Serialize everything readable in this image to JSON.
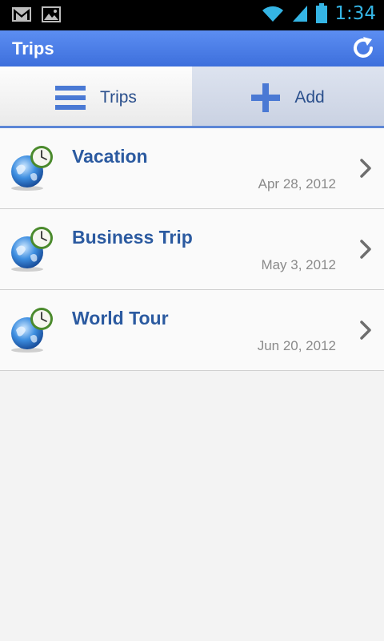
{
  "status_bar": {
    "time": "1:34",
    "icons": [
      "gmail-icon",
      "gallery-icon",
      "wifi-icon",
      "signal-icon",
      "battery-icon"
    ]
  },
  "action_bar": {
    "title": "Trips",
    "refresh_icon": "refresh-icon"
  },
  "tabs": [
    {
      "label": "Trips",
      "icon": "list-icon",
      "selected": true
    },
    {
      "label": "Add",
      "icon": "plus-icon",
      "selected": false
    }
  ],
  "trips": [
    {
      "title": "Vacation",
      "date": "Apr 28, 2012"
    },
    {
      "title": "Business Trip",
      "date": "May 3, 2012"
    },
    {
      "title": "World Tour",
      "date": "Jun 20, 2012"
    }
  ],
  "colors": {
    "accent": "#3d6fdc",
    "title_text": "#2b5aa0",
    "status_time": "#35b5e5"
  }
}
